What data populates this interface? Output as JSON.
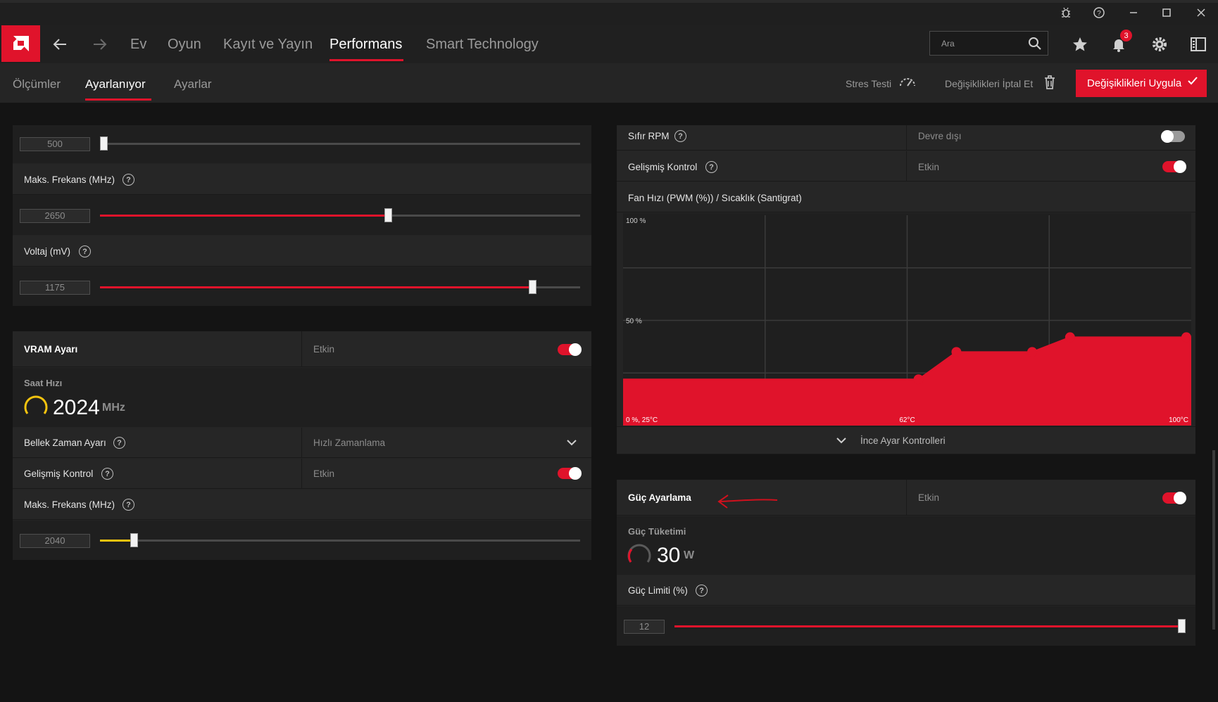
{
  "titlebar": {
    "icons": [
      "bug-icon",
      "help-icon",
      "minimize-icon",
      "maximize-icon",
      "close-icon"
    ]
  },
  "nav": {
    "items": [
      {
        "label": "Ev"
      },
      {
        "label": "Oyun"
      },
      {
        "label": "Kayıt ve Yayın"
      },
      {
        "label": "Performans",
        "active": true
      },
      {
        "label": "Smart Technology"
      }
    ],
    "search_placeholder": "Ara",
    "notification_count": "3"
  },
  "subnav": {
    "tabs": [
      {
        "label": "Ölçümler"
      },
      {
        "label": "Ayarlanıyor",
        "active": true
      },
      {
        "label": "Ayarlar"
      }
    ],
    "stress_test": "Stres Testi",
    "discard": "Değişiklikleri İptal Et",
    "apply": "Değişiklikleri Uygula"
  },
  "gpu": {
    "min_freq_value": "500",
    "min_freq_level": 0.0,
    "max_freq_label": "Maks. Frekans (MHz)",
    "max_freq_value": "2650",
    "max_freq_level": 0.6,
    "voltage_label": "Voltaj (mV)",
    "voltage_value": "1175",
    "voltage_level": 0.9
  },
  "vram": {
    "title": "VRAM Ayarı",
    "status": "Etkin",
    "clock_label": "Saat Hızı",
    "clock_value": "2024",
    "clock_unit": "MHz",
    "timing_label": "Bellek Zaman Ayarı",
    "timing_value": "Hızlı Zamanlama",
    "advanced_label": "Gelişmiş Kontrol",
    "advanced_status": "Etkin",
    "max_freq_label": "Maks. Frekans (MHz)",
    "max_freq_value": "2040",
    "max_freq_level": 0.07
  },
  "fan": {
    "zero_rpm_label": "Sıfır RPM",
    "zero_rpm_status": "Devre dışı",
    "advanced_label": "Gelişmiş Kontrol",
    "advanced_status": "Etkin",
    "curve_title": "Fan Hızı (PWM (%)) / Sıcaklık (Santigrat)",
    "fine_tune": "İnce Ayar Kontrolleri"
  },
  "chart_data": {
    "type": "area",
    "title": "Fan Hızı (PWM (%)) / Sıcaklık (Santigrat)",
    "y_tick_labels": [
      "100 %",
      "50 %",
      "0 %"
    ],
    "x_tick_labels": [
      "25°C",
      "62°C",
      "100°C"
    ],
    "xlim": [
      25,
      100
    ],
    "ylim": [
      0,
      100
    ],
    "x": [
      25,
      64,
      69,
      79,
      84,
      100
    ],
    "y": [
      22,
      22,
      35,
      35,
      42,
      42
    ],
    "point_x": [
      64,
      69,
      79,
      84,
      100
    ],
    "point_y": [
      22,
      35,
      35,
      42,
      42
    ],
    "color": "#e0132b"
  },
  "power": {
    "title": "Güç Ayarlama",
    "status": "Etkin",
    "consumption_label": "Güç Tüketimi",
    "consumption_value": "30",
    "consumption_unit": "W",
    "limit_label": "Güç Limiti (%)",
    "limit_value": "12",
    "limit_level": 1.0
  },
  "colors": {
    "accent": "#e0132b",
    "vram_slider": "#f3c30f",
    "gauge_yellow": "#f3c30f"
  }
}
